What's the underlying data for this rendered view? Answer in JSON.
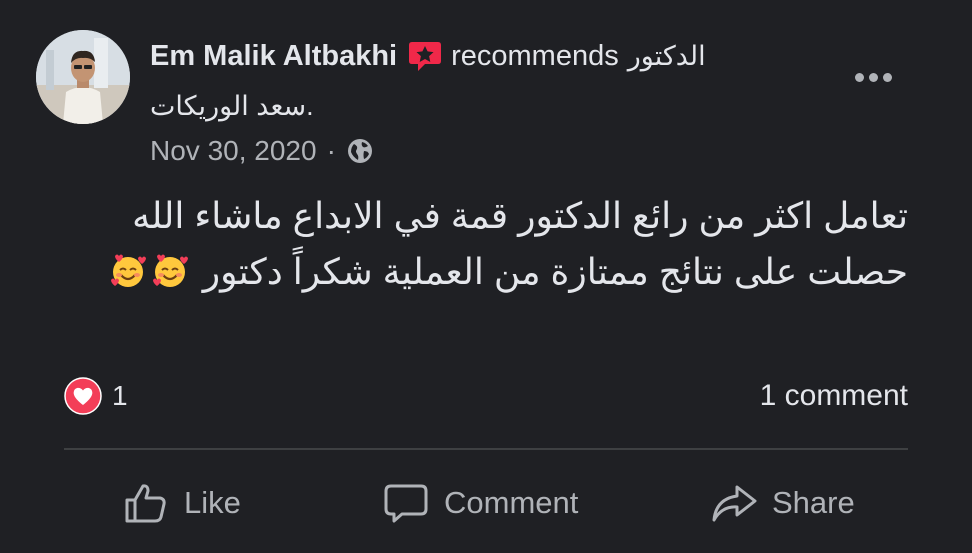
{
  "post": {
    "author": "Em Malik Altbakhi",
    "action_text": "recommends",
    "page_name_part1": "الدكتور",
    "page_name_part2": "سعد الوريكات.",
    "date": "Nov 30, 2020",
    "separator": "·",
    "body_line1": "تعامل اكثر من رائع الدكتور قمة في الابداع ماشاء الله",
    "body_line2": "حصلت على نتائج ممتازة من العملية شكراً دكتور",
    "body_emoji": "smiling-face-with-hearts",
    "reaction_count": "1",
    "comment_count_text": "1 comment"
  },
  "actions": {
    "like_label": "Like",
    "comment_label": "Comment",
    "share_label": "Share"
  },
  "icons": {
    "recommend": "recommend-star-bubble-icon",
    "privacy": "globe-icon",
    "reaction": "love-heart-icon",
    "more": "more-dots-icon",
    "like": "thumbs-up-icon",
    "comment": "speech-bubble-icon",
    "share": "share-arrow-icon"
  },
  "colors": {
    "background": "#1f2024",
    "primary_text": "#e4e6eb",
    "secondary_text": "#b0b3b8",
    "recommend_red": "#f02849",
    "love_red": "#f33e58",
    "divider": "#3e4042"
  }
}
